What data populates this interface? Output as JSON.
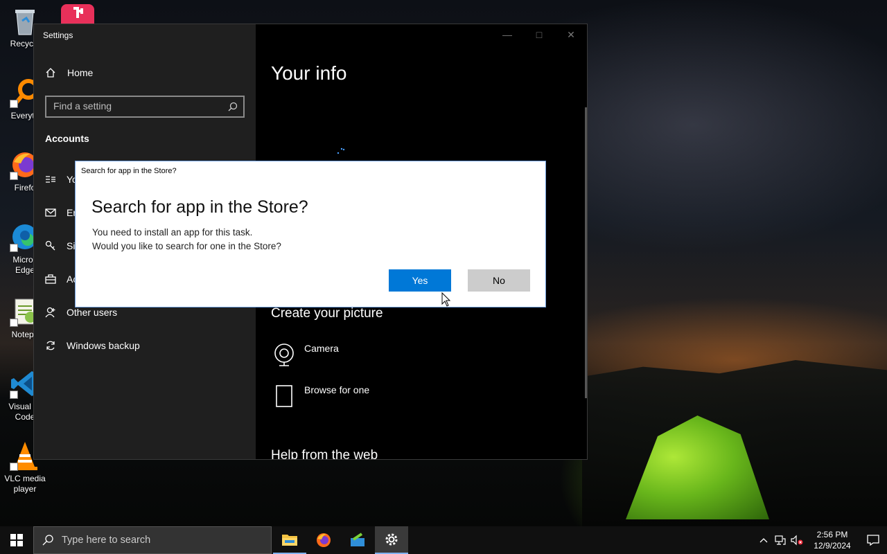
{
  "desktop": {
    "icons": [
      {
        "label": "Recycle"
      },
      {
        "label": "Everyth"
      },
      {
        "label": "Firefo"
      },
      {
        "label": "Micros\nEdge"
      },
      {
        "label": "Notepa"
      },
      {
        "label": "Visual St\nCode"
      },
      {
        "label": "VLC media\nplayer"
      }
    ]
  },
  "settings": {
    "title": "Settings",
    "home_label": "Home",
    "search_placeholder": "Find a setting",
    "section": "Accounts",
    "nav": [
      {
        "label": "Yo",
        "icon": "person-card-icon"
      },
      {
        "label": "Er",
        "icon": "mail-icon"
      },
      {
        "label": "Si",
        "icon": "key-icon"
      },
      {
        "label": "Ac",
        "icon": "briefcase-icon"
      },
      {
        "label": "Other users",
        "icon": "person-add-icon"
      },
      {
        "label": "Windows backup",
        "icon": "sync-icon"
      }
    ],
    "page_title": "Your info",
    "create_picture_heading": "Create your picture",
    "picture_options": [
      {
        "label": "Camera",
        "icon": "camera-icon"
      },
      {
        "label": "Browse for one",
        "icon": "file-icon"
      }
    ],
    "help_heading": "Help from the web"
  },
  "dialog": {
    "title": "Search for app in the Store?",
    "heading": "Search for app in the Store?",
    "line1": "You need to install an app for this task.",
    "line2": "Would you like to search for one in the Store?",
    "yes_label": "Yes",
    "no_label": "No"
  },
  "taskbar": {
    "search_placeholder": "Type here to search",
    "time": "2:56 PM",
    "date": "12/9/2024"
  },
  "colors": {
    "accent": "#0078d7",
    "dialog_bg": "#ffffff",
    "settings_bg": "#000000"
  }
}
